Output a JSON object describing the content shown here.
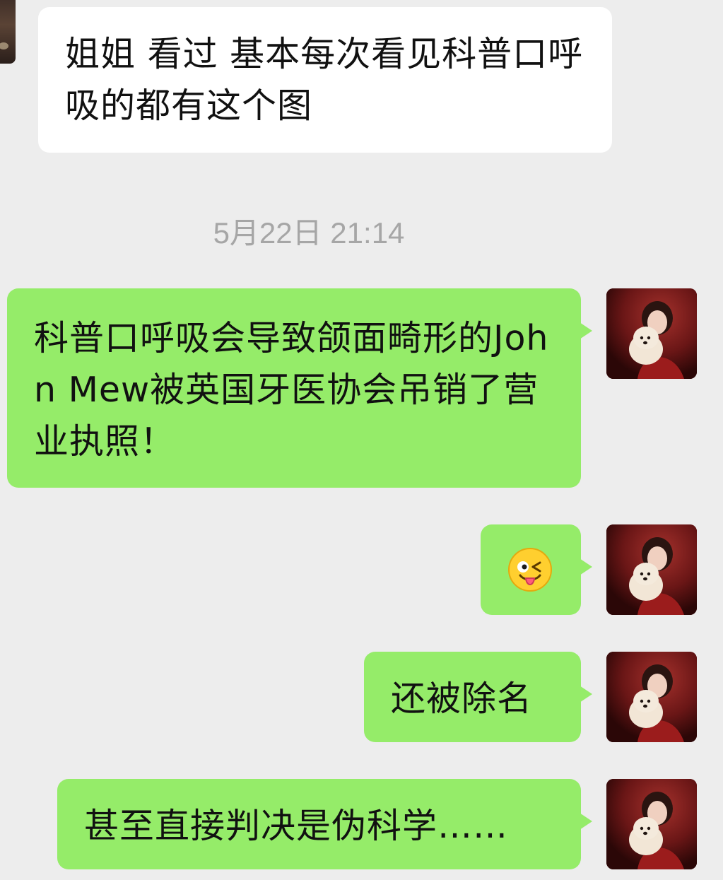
{
  "chat": {
    "messages": [
      {
        "id": "m1",
        "direction": "incoming",
        "type": "text",
        "text": "姐姐  看过 基本每次看见科普口呼吸的都有这个图"
      },
      {
        "id": "m2",
        "direction": "outgoing",
        "type": "text",
        "text": "科普口呼吸会导致颌面畸形的John Mew被英国牙医协会吊销了营业执照！"
      },
      {
        "id": "m3",
        "direction": "outgoing",
        "type": "emoji",
        "emoji_name": "wink-tongue-emoji"
      },
      {
        "id": "m4",
        "direction": "outgoing",
        "type": "text",
        "text": "还被除名"
      },
      {
        "id": "m5",
        "direction": "outgoing",
        "type": "text",
        "text": "甚至直接判决是伪科学……"
      }
    ],
    "timestamp": "5月22日 21:14"
  },
  "colors": {
    "background": "#ededed",
    "incoming_bubble": "#ffffff",
    "outgoing_bubble": "#95ec69",
    "timestamp_text": "#a6a6a6",
    "message_text": "#111111"
  },
  "icons": {
    "self_avatar": "avatar-woman-with-dog-icon",
    "other_avatar": "avatar-cropped-icon"
  }
}
